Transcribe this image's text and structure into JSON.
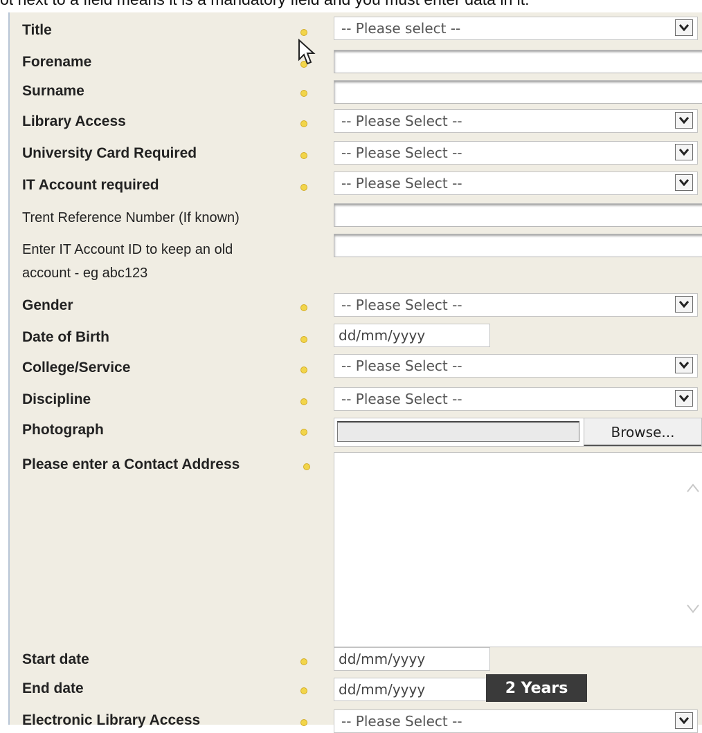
{
  "banner": "ot next to a field means it is a mandatory field and you must enter data in it.",
  "fields": {
    "title": {
      "label": "Title",
      "value": "-- Please select --"
    },
    "forename": {
      "label": "Forename",
      "value": ""
    },
    "surname": {
      "label": "Surname",
      "value": ""
    },
    "library_access": {
      "label": "Library Access",
      "value": "-- Please Select --"
    },
    "university_card": {
      "label": "University Card Required",
      "value": "-- Please Select --"
    },
    "it_account": {
      "label": "IT Account required",
      "value": "-- Please Select --"
    },
    "trent_ref": {
      "label": "Trent Reference Number (If known)",
      "value": ""
    },
    "it_account_id": {
      "label_line1": "Enter IT Account ID to keep an old",
      "label_line2": "account - eg abc123",
      "value": ""
    },
    "gender": {
      "label": "Gender",
      "value": "-- Please Select --"
    },
    "dob": {
      "label": "Date of Birth",
      "placeholder": "dd/mm/yyyy"
    },
    "college": {
      "label": "College/Service",
      "value": "-- Please Select --"
    },
    "discipline": {
      "label": "Discipline",
      "value": "-- Please Select --"
    },
    "photograph": {
      "label": "Photograph",
      "browse_label": "Browse..."
    },
    "contact_address": {
      "label": "Please enter a Contact Address",
      "value": ""
    },
    "start_date": {
      "label": "Start date",
      "placeholder": "dd/mm/yyyy"
    },
    "end_date": {
      "label": "End date",
      "placeholder": "dd/mm/yyyy",
      "button": "2 Years"
    },
    "electronic_library": {
      "label": "Electronic Library Access",
      "value": "-- Please Select --"
    }
  },
  "colors": {
    "panel": "#f0ede3",
    "mandatory_dot": "#f2d54a",
    "button": "#3a3a3a"
  },
  "icons": [
    "mandatory-dot-icon",
    "dropdown-arrow-icon",
    "scroll-up-icon",
    "scroll-down-icon",
    "mouse-cursor-icon"
  ]
}
